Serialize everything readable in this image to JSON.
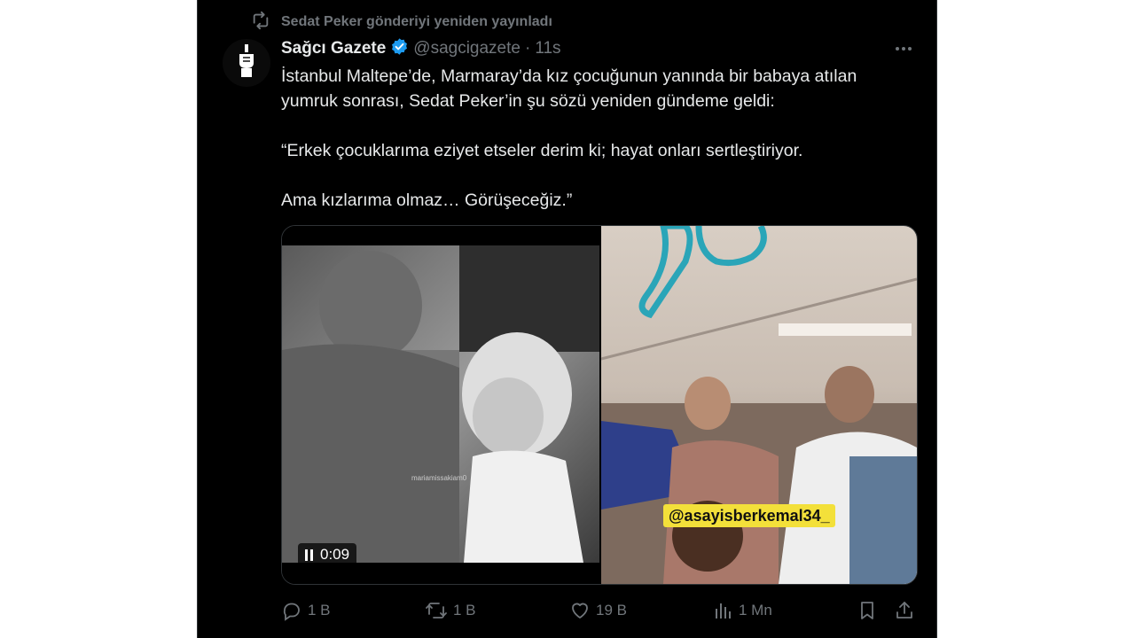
{
  "repost": {
    "icon": "repost-icon",
    "label": "Sedat Peker gönderiyi yeniden yayınladı"
  },
  "tweet": {
    "author_name": "Sağcı Gazete",
    "verified": true,
    "handle": "@sagcigazete",
    "separator": "·",
    "time": "11s",
    "paragraphs": [
      "İstanbul Maltepe’de, Marmaray’da kız çocuğunun yanında bir babaya atılan yumruk sonrası, Sedat Peker’in şu sözü yeniden gündeme geldi:",
      "“Erkek çocuklarıma eziyet etseler derim ki; hayat onları sertleştiriyor.",
      "Ama kızlarıma olmaz… Görüşeceğiz.”"
    ]
  },
  "media": {
    "video_time": "0:09",
    "left_watermark": "mariamissakiam0",
    "right_watermark": "@asayisberkemal34_"
  },
  "actions": {
    "reply_count": "1 B",
    "repost_count": "1 B",
    "like_count": "19 B",
    "views_count": "1 Mn"
  },
  "colors": {
    "background": "#000000",
    "text": "#e7e9ea",
    "muted": "#71767b",
    "verified": "#1d9bf0",
    "watermark_bg": "#f3e03a"
  }
}
